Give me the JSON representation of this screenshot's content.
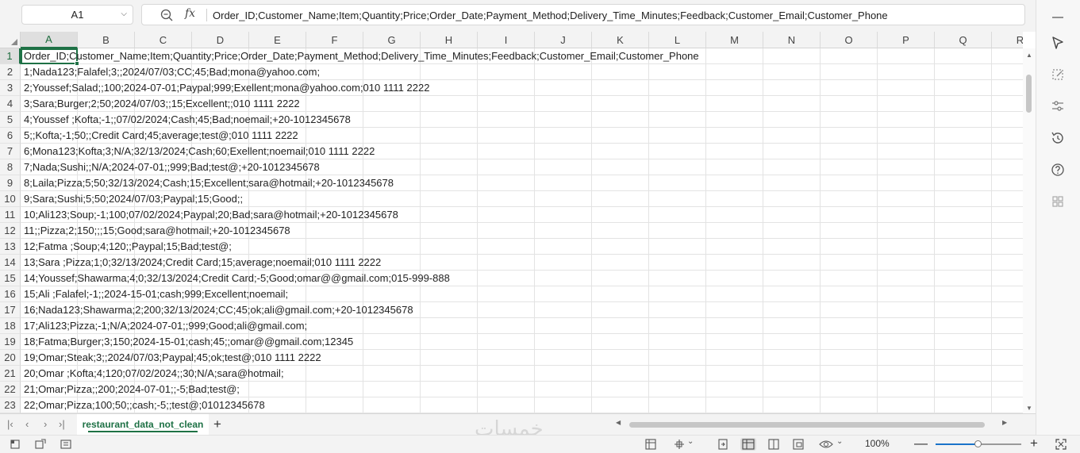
{
  "name_box": {
    "value": "A1"
  },
  "formula_bar": {
    "fx_label": "fx",
    "content": "Order_ID;Customer_Name;Item;Quantity;Price;Order_Date;Payment_Method;Delivery_Time_Minutes;Feedback;Customer_Email;Customer_Phone"
  },
  "columns": [
    "A",
    "B",
    "C",
    "D",
    "E",
    "F",
    "G",
    "H",
    "I",
    "J",
    "K",
    "L",
    "M",
    "N",
    "O",
    "P",
    "Q",
    "R"
  ],
  "rows": [
    {
      "num": "1",
      "text": "Order_ID;Customer_Name;Item;Quantity;Price;Order_Date;Payment_Method;Delivery_Time_Minutes;Feedback;Customer_Email;Customer_Phone"
    },
    {
      "num": "2",
      "text": "1;Nada123;Falafel;3;;2024/07/03;CC;45;Bad;mona@yahoo.com;"
    },
    {
      "num": "3",
      "text": "2;Youssef;Salad;;100;2024-07-01;Paypal;999;Exellent;mona@yahoo.com;010 1111 2222"
    },
    {
      "num": "4",
      "text": "3;Sara;Burger;2;50;2024/07/03;;15;Excellent;;010 1111 2222"
    },
    {
      "num": "5",
      "text": "4;Youssef ;Kofta;-1;;07/02/2024;Cash;45;Bad;noemail;+20-1012345678"
    },
    {
      "num": "6",
      "text": "5;;Kofta;-1;50;;Credit Card;45;average;test@;010 1111 2222"
    },
    {
      "num": "7",
      "text": "6;Mona123;Kofta;3;N/A;32/13/2024;Cash;60;Exellent;noemail;010 1111 2222"
    },
    {
      "num": "8",
      "text": "7;Nada;Sushi;;N/A;2024-07-01;;999;Bad;test@;+20-1012345678"
    },
    {
      "num": "9",
      "text": "8;Laila;Pizza;5;50;32/13/2024;Cash;15;Excellent;sara@hotmail;+20-1012345678"
    },
    {
      "num": "10",
      "text": "9;Sara;Sushi;5;50;2024/07/03;Paypal;15;Good;;"
    },
    {
      "num": "11",
      "text": "10;Ali123;Soup;-1;100;07/02/2024;Paypal;20;Bad;sara@hotmail;+20-1012345678"
    },
    {
      "num": "12",
      "text": "11;;Pizza;2;150;;;15;Good;sara@hotmail;+20-1012345678"
    },
    {
      "num": "13",
      "text": "12;Fatma ;Soup;4;120;;Paypal;15;Bad;test@;"
    },
    {
      "num": "14",
      "text": "13;Sara ;Pizza;1;0;32/13/2024;Credit Card;15;average;noemail;010 1111 2222"
    },
    {
      "num": "15",
      "text": "14;Youssef;Shawarma;4;0;32/13/2024;Credit Card;-5;Good;omar@@gmail.com;015-999-888"
    },
    {
      "num": "16",
      "text": "15;Ali ;Falafel;-1;;2024-15-01;cash;999;Excellent;noemail;"
    },
    {
      "num": "17",
      "text": "16;Nada123;Shawarma;2;200;32/13/2024;CC;45;ok;ali@gmail.com;+20-1012345678"
    },
    {
      "num": "18",
      "text": "17;Ali123;Pizza;-1;N/A;2024-07-01;;999;Good;ali@gmail.com;"
    },
    {
      "num": "19",
      "text": "18;Fatma;Burger;3;150;2024-15-01;cash;45;;omar@@gmail.com;12345"
    },
    {
      "num": "20",
      "text": "19;Omar;Steak;3;;2024/07/03;Paypal;45;ok;test@;010 1111 2222"
    },
    {
      "num": "21",
      "text": "20;Omar ;Kofta;4;120;07/02/2024;;30;N/A;sara@hotmail;"
    },
    {
      "num": "22",
      "text": "21;Omar;Pizza;;200;2024-07-01;;-5;Bad;test@;"
    },
    {
      "num": "23",
      "text": "22;Omar;Pizza;100;50;;cash;-5;;test@;01012345678"
    }
  ],
  "sheet_tab": {
    "name": "restaurant_data_not_clean"
  },
  "watermark": "خمسات",
  "status_bar": {
    "zoom": "100%",
    "zoom_fraction": 0.5
  },
  "colors": {
    "accent": "#1e7145",
    "zoom_fill": "#1a73c9"
  },
  "icons": {
    "right_pane": [
      "minimize-icon",
      "pointer-select-icon",
      "relative-reference-icon",
      "filter-settings-icon",
      "history-icon",
      "help-icon",
      "grid-app-icon"
    ],
    "status_bar": [
      "cell-mode-icon",
      "accessibility-icon",
      "page-layout-icon",
      "table-format-icon",
      "move-icon",
      "layout-normal-icon",
      "layout-page-icon",
      "layout-break-icon",
      "view-eye-icon"
    ]
  }
}
